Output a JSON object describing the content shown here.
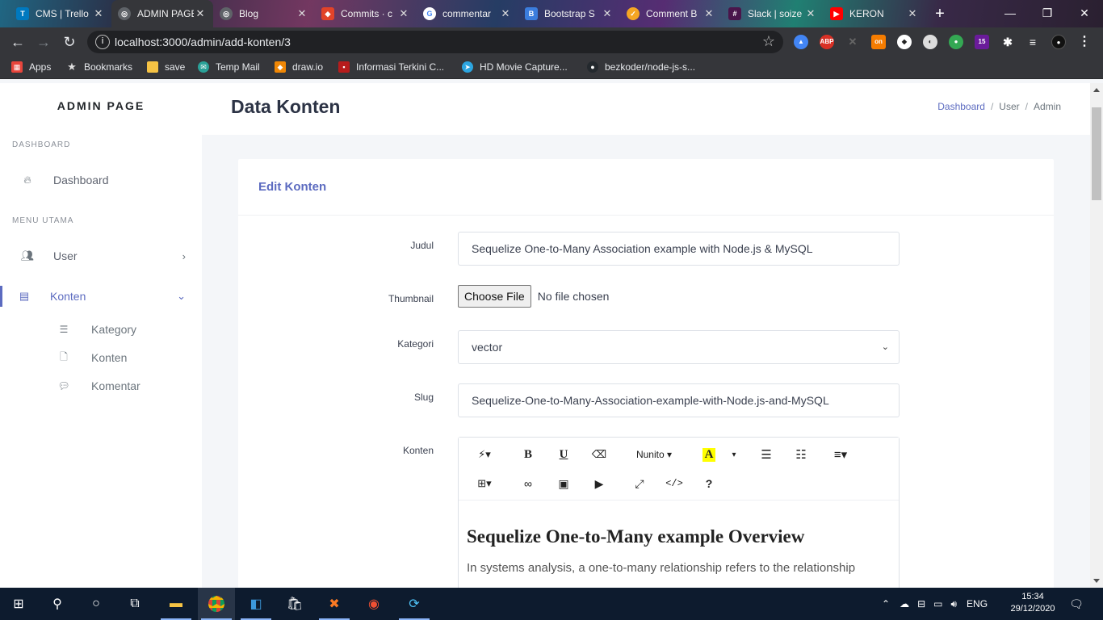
{
  "browser": {
    "tabs": [
      {
        "title": "CMS | Trello",
        "favicon_color": "#0079bf",
        "favicon": "T"
      },
      {
        "title": "ADMIN PAGE",
        "favicon_color": "#5f6368",
        "favicon": "◎"
      },
      {
        "title": "Blog",
        "favicon_color": "#5f6368",
        "favicon": "◎"
      },
      {
        "title": "Commits · c",
        "favicon_color": "#e24329",
        "favicon": "◆"
      },
      {
        "title": "commentar",
        "favicon_color": "#ffffff",
        "favicon": "G"
      },
      {
        "title": "Bootstrap S",
        "favicon_color": "#3b7ddd",
        "favicon": "B"
      },
      {
        "title": "Comment B",
        "favicon_color": "#f5a623",
        "favicon": "✓"
      },
      {
        "title": "Slack | soize",
        "favicon_color": "#4a154b",
        "favicon": "#"
      },
      {
        "title": "KERON",
        "favicon_color": "#ff0000",
        "favicon": "▶"
      }
    ],
    "new_tab": "+",
    "window_controls": {
      "minimize": "—",
      "maximize": "❐",
      "close": "✕"
    },
    "url": "localhost:3000/admin/add-konten/3",
    "bookmarks": [
      {
        "label": "Apps",
        "color": "#e8453c"
      },
      {
        "label": "Bookmarks",
        "color": "#9aa0a6"
      },
      {
        "label": "save",
        "color": "#f6c344"
      },
      {
        "label": "Temp Mail",
        "color": "#2aa198"
      },
      {
        "label": "draw.io",
        "color": "#f08705"
      },
      {
        "label": "Informasi Terkini C...",
        "color": "#b71c1c"
      },
      {
        "label": "HD Movie Capture...",
        "color": "#2ca5e0"
      },
      {
        "label": "bezkoder/node-js-s...",
        "color": "#24292e"
      }
    ],
    "extension_badge": "15"
  },
  "sidebar": {
    "brand": "ADMIN PAGE",
    "section_dashboard": "DASHBOARD",
    "section_menu": "MENU UTAMA",
    "items": [
      {
        "label": "Dashboard",
        "icon": "fire-icon"
      },
      {
        "label": "User",
        "icon": "users-icon"
      },
      {
        "label": "Konten",
        "icon": "list-alt-icon"
      }
    ],
    "sub_items": [
      {
        "label": "Kategory",
        "icon": "list-icon"
      },
      {
        "label": "Konten",
        "icon": "file-icon"
      },
      {
        "label": "Komentar",
        "icon": "comments-icon"
      }
    ]
  },
  "header": {
    "title": "Data Konten",
    "breadcrumb": [
      "Dashboard",
      "User",
      "Admin"
    ]
  },
  "form": {
    "card_title": "Edit Konten",
    "judul_label": "Judul",
    "judul_value": "Sequelize One-to-Many Association example with Node.js & MySQL",
    "thumbnail_label": "Thumbnail",
    "file_button": "Choose File",
    "file_status": "No file chosen",
    "kategori_label": "Kategori",
    "kategori_value": "vector",
    "slug_label": "Slug",
    "slug_value": "Sequelize-One-to-Many-Association-example-with-Node.js-and-MySQL",
    "konten_label": "Konten",
    "editor": {
      "font_name": "Nunito",
      "heading": "Sequelize One-to-Many example Overview",
      "paragraph": "In systems analysis, a one-to-many relationship refers to the relationship"
    }
  },
  "taskbar": {
    "language": "ENG",
    "time": "15:34",
    "date": "29/12/2020"
  }
}
